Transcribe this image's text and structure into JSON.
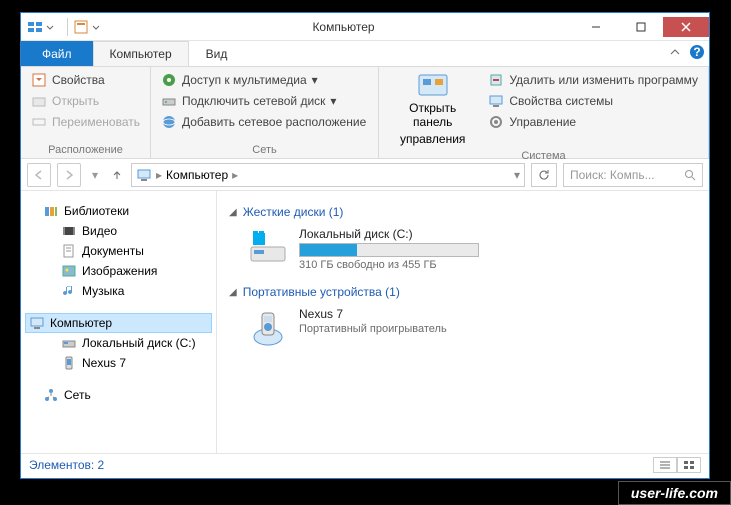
{
  "title": "Компьютер",
  "tabs": {
    "file": "Файл",
    "computer": "Компьютер",
    "view": "Вид"
  },
  "ribbon": {
    "location": {
      "label": "Расположение",
      "properties": "Свойства",
      "open": "Открыть",
      "rename": "Переименовать"
    },
    "network": {
      "label": "Сеть",
      "media": "Доступ к мультимедиа",
      "mapdrive": "Подключить сетевой диск",
      "addloc": "Добавить сетевое расположение"
    },
    "controlpanel": {
      "line1": "Открыть панель",
      "line2": "управления"
    },
    "system": {
      "label": "Система",
      "uninstall": "Удалить или изменить программу",
      "sysprops": "Свойства системы",
      "manage": "Управление"
    }
  },
  "nav": {
    "crumb": "Компьютер",
    "searchPlaceholder": "Поиск: Компь..."
  },
  "tree": {
    "libraries": "Библиотеки",
    "video": "Видео",
    "documents": "Документы",
    "pictures": "Изображения",
    "music": "Музыка",
    "computer": "Компьютер",
    "localdisk": "Локальный диск (C:)",
    "nexus": "Nexus 7",
    "network": "Сеть"
  },
  "groups": {
    "hdd": {
      "title": "Жесткие диски (1)",
      "disk": {
        "name": "Локальный диск (C:)",
        "free": "310 ГБ свободно из 455 ГБ",
        "fillPercent": 32
      }
    },
    "portable": {
      "title": "Портативные устройства (1)",
      "dev": {
        "name": "Nexus 7",
        "sub": "Портативный проигрыватель"
      }
    }
  },
  "status": "Элементов: 2",
  "watermark": "user-life.com"
}
